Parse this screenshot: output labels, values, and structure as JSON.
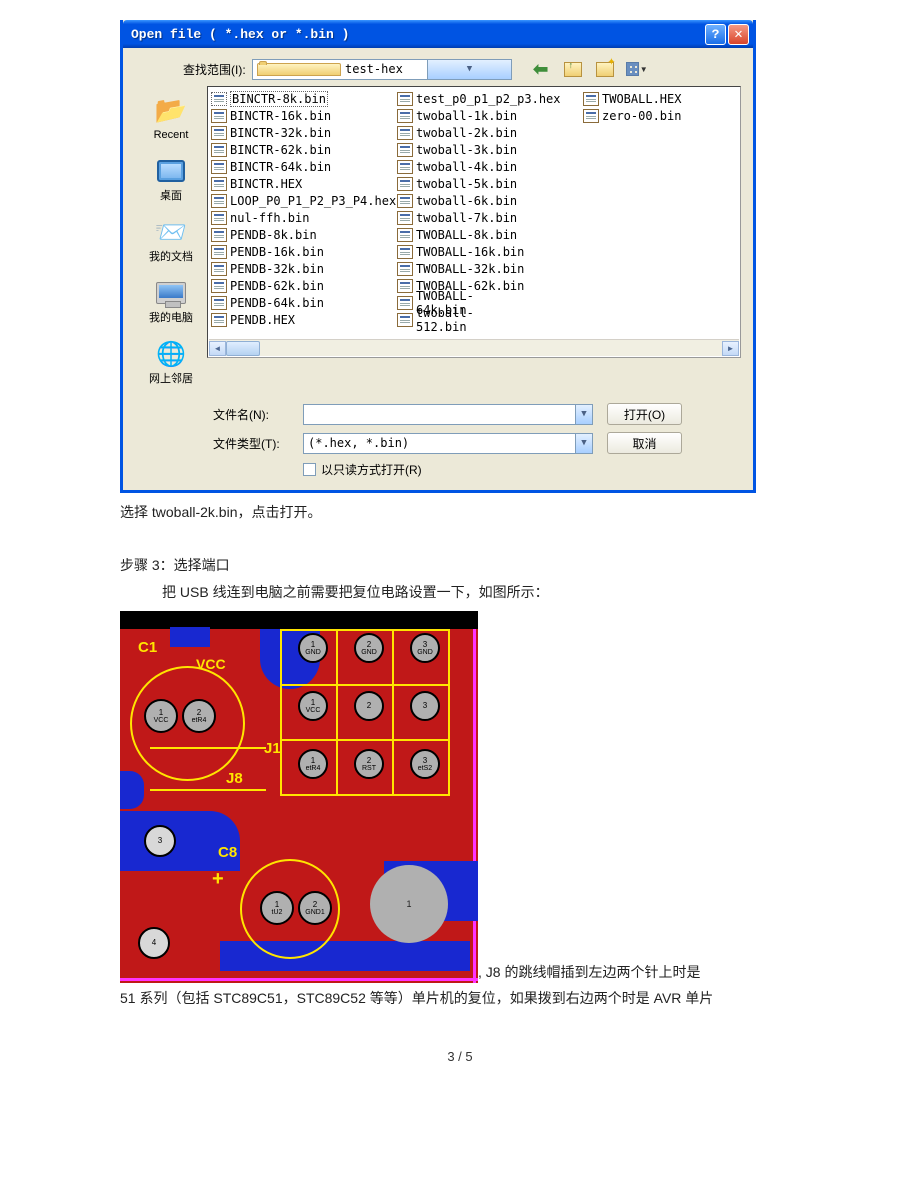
{
  "dialog": {
    "title": "Open file ( *.hex or *.bin )",
    "lookup_label": "查找范围(I):",
    "folder_name": "test-hex",
    "filename_label": "文件名(N):",
    "filename_value": "",
    "filetype_label": "文件类型(T):",
    "filetype_value": "(*.hex, *.bin)",
    "readonly_label": "以只读方式打开(R)",
    "open_btn": "打开(O)",
    "cancel_btn": "取消",
    "places": [
      {
        "label": "Recent"
      },
      {
        "label": "桌面"
      },
      {
        "label": "我的文档"
      },
      {
        "label": "我的电脑"
      },
      {
        "label": "网上邻居"
      }
    ],
    "files_col1": [
      "BINCTR-8k.bin",
      "BINCTR-16k.bin",
      "BINCTR-32k.bin",
      "BINCTR-62k.bin",
      "BINCTR-64k.bin",
      "BINCTR.HEX",
      "LOOP_P0_P1_P2_P3_P4.hex",
      "nul-ffh.bin",
      "PENDB-8k.bin",
      "PENDB-16k.bin",
      "PENDB-32k.bin",
      "PENDB-62k.bin",
      "PENDB-64k.bin"
    ],
    "files_col2": [
      "PENDB.HEX",
      "test_p0_p1_p2_p3.hex",
      "twoball-1k.bin",
      "twoball-2k.bin",
      "twoball-3k.bin",
      "twoball-4k.bin",
      "twoball-5k.bin",
      "twoball-6k.bin",
      "twoball-7k.bin",
      "TWOBALL-8k.bin",
      "TWOBALL-16k.bin",
      "TWOBALL-32k.bin",
      "TWOBALL-62k.bin"
    ],
    "files_col3": [
      "TWOBALL-64k.bin",
      "twoball-512.bin",
      "TWOBALL.HEX",
      "zero-00.bin"
    ]
  },
  "doc": {
    "caption": "选择 twoball-2k.bin，点击打开。",
    "step3": "步骤 3：选择端口",
    "step3_body": "把 USB 线连到电脑之前需要把复位电路设置一下，如图所示：",
    "after_pcb_inline": ", J8 的跳线帽插到左边两个针上时是",
    "after_pcb_line2": "51 系列（包括 STC89C51，STC89C52 等等）单片机的复位，如果拨到右边两个时是 AVR 单片",
    "footer": "3 / 5"
  },
  "pcb": {
    "labels": {
      "c1": "C1",
      "vcc_txt": "VCC",
      "j1": "J1",
      "j8": "J8",
      "c8": "C8",
      "gnd_top": "GND"
    },
    "pads": {
      "vcc": {
        "n": "1",
        "t": "VCC"
      },
      "etr4": {
        "n": "2",
        "t": "etR4"
      },
      "gnd1": {
        "n": "1",
        "t": "GND"
      },
      "gnd2": {
        "n": "2",
        "t": "GND"
      },
      "gnd3": {
        "n": "3",
        "t": "GND"
      },
      "vcc2": {
        "n": "1",
        "t": "VCC"
      },
      "p22": {
        "n": "2",
        "t": ""
      },
      "p23": {
        "n": "3",
        "t": ""
      },
      "etr4b": {
        "n": "1",
        "t": "etR4"
      },
      "rst": {
        "n": "2",
        "t": "RST"
      },
      "ets2": {
        "n": "3",
        "t": "etS2"
      },
      "p3": {
        "n": "3",
        "t": ""
      },
      "p4": {
        "n": "4",
        "t": ""
      },
      "tu2": {
        "n": "1",
        "t": "tU2"
      },
      "gnd1b": {
        "n": "2",
        "t": "GND1"
      },
      "big1": {
        "n": "1",
        "t": ""
      }
    }
  }
}
